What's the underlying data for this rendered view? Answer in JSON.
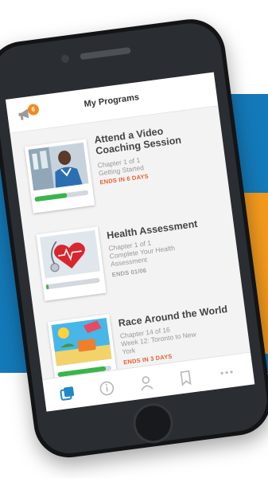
{
  "header": {
    "title": "My Programs",
    "badge_count": "6",
    "icon": "megaphone-icon"
  },
  "cards": [
    {
      "title_line1": "Attend a Video",
      "title_line2": "Coaching Session",
      "sub_line1": "Chapter 1 of 1",
      "sub_line2": "Getting Started",
      "sub_line3": "",
      "due": "ENDS IN 6 DAYS",
      "due_color": "#e2612a",
      "progress": 0.6,
      "thumb": "coach-man-thumbnail"
    },
    {
      "title_line1": "Health Assessment",
      "title_line2": "",
      "sub_line1": "Chapter 1 of 1",
      "sub_line2": "Complete Your Health",
      "sub_line3": "Assessment",
      "due": "ENDS 01/06",
      "due_color": "#a0a0a0",
      "progress": 0.05,
      "thumb": "stethoscope-heart-thumbnail"
    },
    {
      "title_line1": "Race Around the World",
      "title_line2": "",
      "sub_line1": "Chapter 14 of 16",
      "sub_line2": "Week 12: Toronto to New",
      "sub_line3": "York",
      "due": "ENDS IN 3 DAYS",
      "due_color": "#e2612a",
      "progress": 0.9,
      "thumb": "travel-beach-thumbnail"
    }
  ],
  "tabbar": {
    "items": [
      "programs-icon",
      "info-icon",
      "profile-icon",
      "bookmark-icon",
      "more-icon"
    ],
    "active_color": "#1e88c8",
    "inactive_color": "#b7b7b7"
  },
  "colors": {
    "brand_blue": "#1479b8",
    "brand_orange": "#f39a1e",
    "progress_green": "#39b54a"
  }
}
